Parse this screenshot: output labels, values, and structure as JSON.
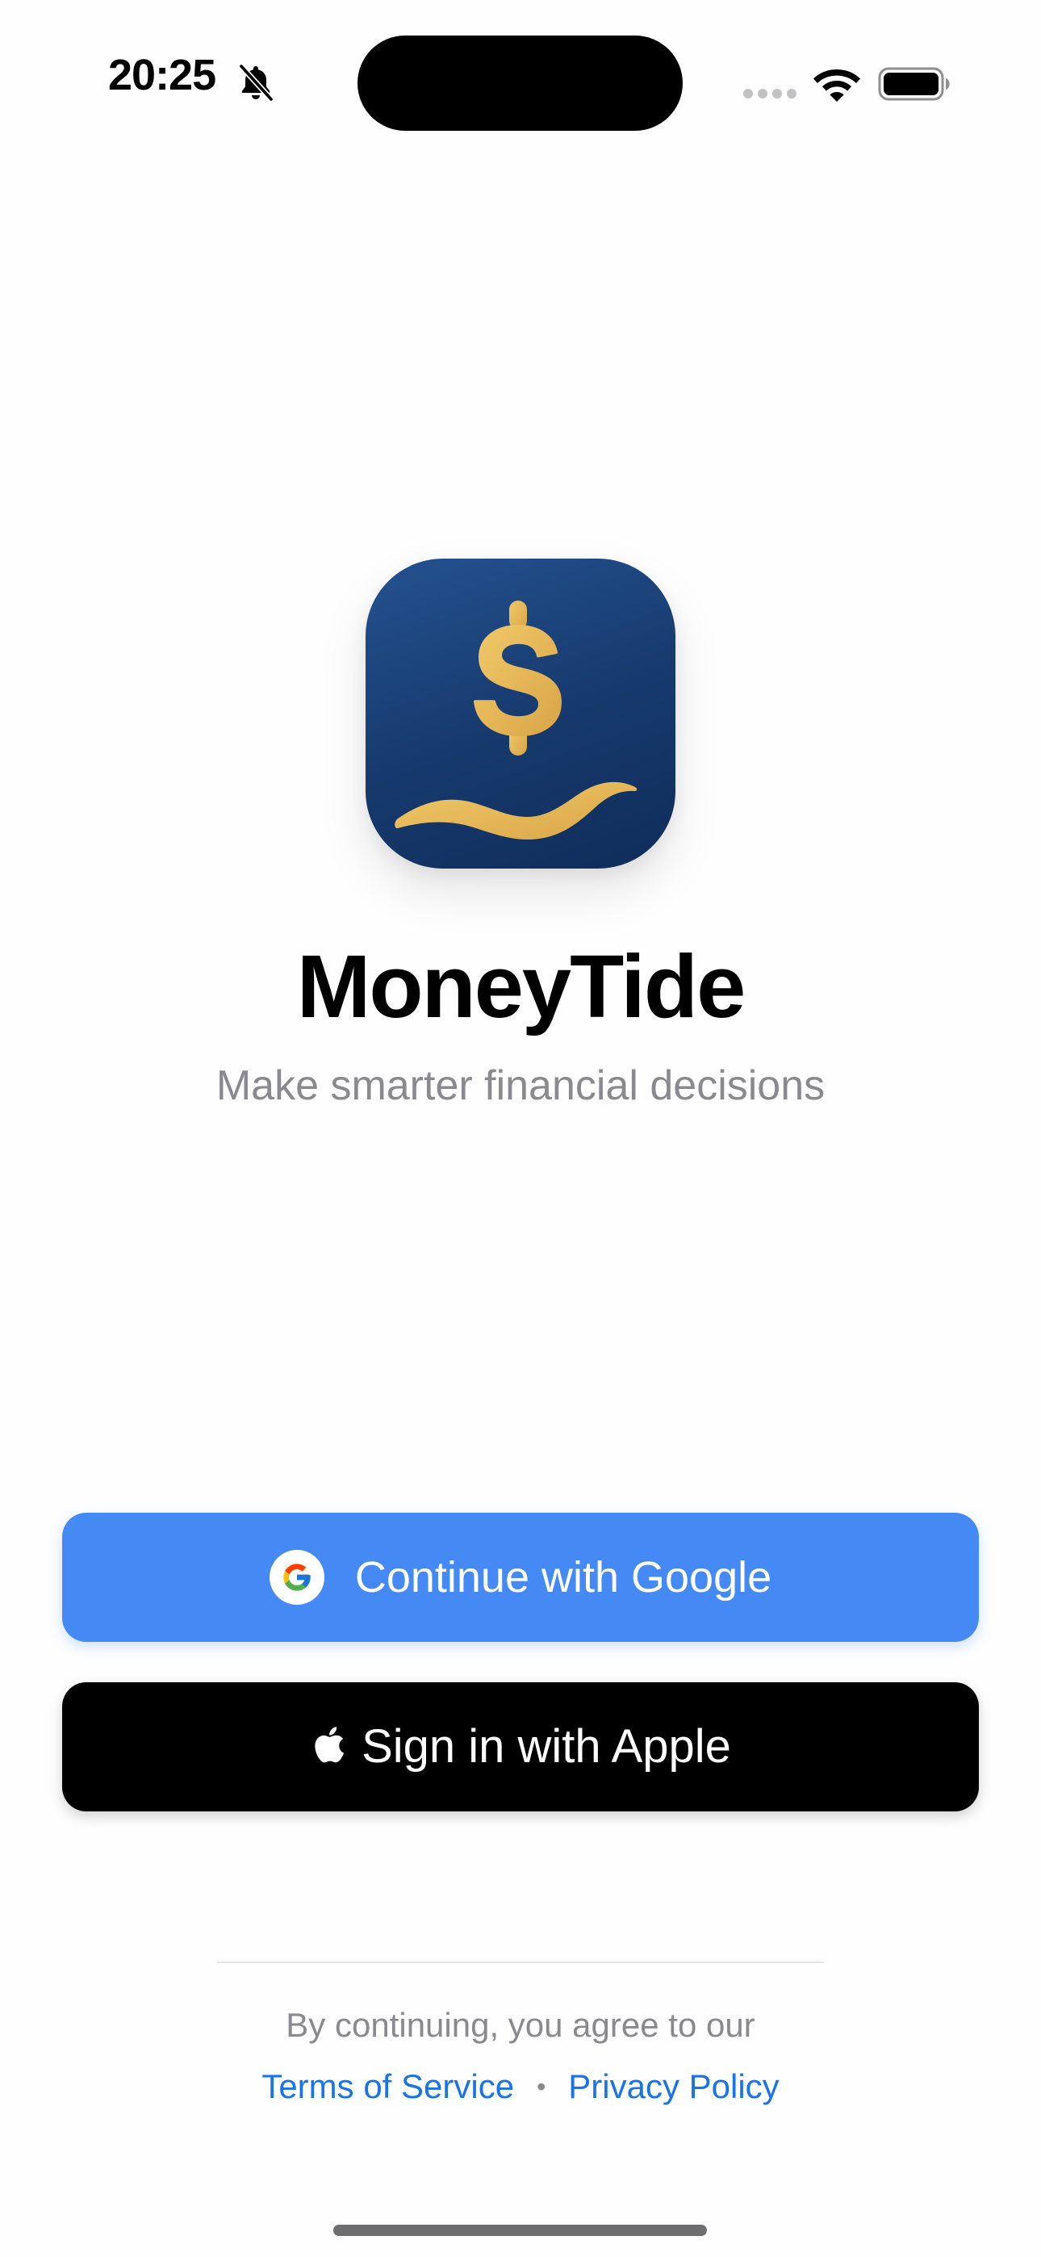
{
  "status_bar": {
    "time": "20:25",
    "silent_icon": "bell-slash-icon",
    "signal_icon": "cellular-dots-icon",
    "wifi_icon": "wifi-icon",
    "battery_icon": "battery-full-icon"
  },
  "app": {
    "name": "MoneyTide",
    "tagline": "Make smarter financial decisions",
    "icon": "dollar-wave-logo",
    "icon_colors": {
      "background": "#1a3f75",
      "accent": "#e6b85a"
    }
  },
  "auth": {
    "google_label": "Continue with Google",
    "google_icon": "google-g-icon",
    "google_color": "#4589f5",
    "apple_label": "Sign in with Apple",
    "apple_icon": "apple-logo-icon",
    "apple_color": "#000000"
  },
  "legal": {
    "notice": "By continuing, you agree to our",
    "terms_label": "Terms of Service",
    "separator": "•",
    "privacy_label": "Privacy Policy",
    "link_color": "#1a73e8"
  }
}
